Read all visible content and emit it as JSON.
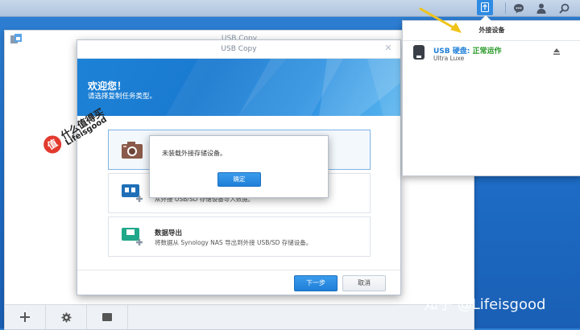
{
  "colors": {
    "accent": "#1f7fd8",
    "status_green": "#2a9a2a",
    "desktop": "#1e6fc9"
  },
  "taskbar": {
    "icons": [
      "upload-icon",
      "chat-icon",
      "user-icon",
      "search-icon"
    ]
  },
  "background_window": {
    "title": "USB Copy",
    "bottom_icons": [
      "plus-icon",
      "gear-icon",
      "minus-icon"
    ]
  },
  "dialog": {
    "title": "USB Copy",
    "close_glyph": "✕",
    "welcome": "欢迎您！",
    "welcome_sub": "请选择复制任务类型。",
    "options": [
      {
        "title": "",
        "desc": "",
        "icon": "camera-icon",
        "selected": true
      },
      {
        "title": "",
        "desc": "从外接 USB/SD 存储设备导入数据。",
        "icon": "usb-import-icon",
        "selected": false
      },
      {
        "title": "数据导出",
        "desc": "将数据从 Synology NAS 导出到外接 USB/SD 存储设备。",
        "icon": "usb-export-icon",
        "selected": false
      }
    ],
    "next_label": "下一步",
    "cancel_label": "取消"
  },
  "alert": {
    "message": "未装载外接存储设备。",
    "ok_label": "确定"
  },
  "popup": {
    "title": "外接设备",
    "device_name": "USB 硬盘: ",
    "device_status": "正常运作",
    "device_model": "Ultra Luxe"
  },
  "watermarks": {
    "left_logo": "值",
    "left_line1": "什么值得买",
    "left_line2": "Lifeisgood",
    "right": "知乎 @Lifeisgood"
  }
}
